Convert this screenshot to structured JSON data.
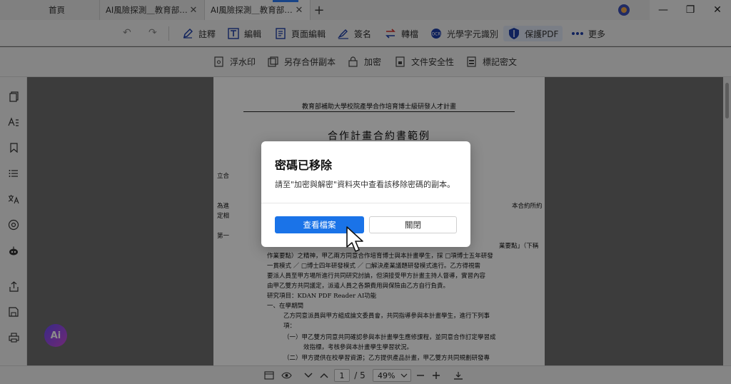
{
  "tabs": [
    {
      "label": "首頁"
    },
    {
      "label": "AI風險探測＿教育部補助..."
    },
    {
      "label": "AI風險探測＿教育部補助..."
    }
  ],
  "tab_close_glyph": "✕",
  "new_tab_glyph": "+",
  "window_controls": {
    "minimize": "—",
    "maximize": "❐",
    "close": "✕"
  },
  "toolbar": {
    "undo_glyph": "↶",
    "redo_glyph": "↷",
    "items": [
      {
        "label": "註釋",
        "icon": "pen-icon"
      },
      {
        "label": "編輯",
        "icon": "edit-text-icon"
      },
      {
        "label": "頁面編輯",
        "icon": "page-edit-icon"
      },
      {
        "label": "簽名",
        "icon": "signature-icon"
      },
      {
        "label": "轉檔",
        "icon": "convert-icon"
      },
      {
        "label": "光學字元識別",
        "icon": "ocr-icon"
      },
      {
        "label": "保護PDF",
        "icon": "shield-icon"
      },
      {
        "label": "更多",
        "icon": "more-icon"
      }
    ]
  },
  "subtoolbar": {
    "items": [
      {
        "label": "浮水印"
      },
      {
        "label": "另存合併副本"
      },
      {
        "label": "加密"
      },
      {
        "label": "文件安全性"
      },
      {
        "label": "標記密文"
      }
    ]
  },
  "document": {
    "header": "教育部補助大學校院產學合作培育博士級研發人才計畫",
    "title": "合作計畫合約書範例",
    "lines": [
      "立合",
      "為進",
      "定相",
      "第一",
      "業要點」（下稱",
      "本合約所約",
      "作業要點）之精神，甲乙兩方同意合作培育博士與本計畫學生，採 □項博士五年研發",
      "一貫模式 ／ □博士四年研發模式 ／ □解決產業議題研發模式進行。乙方得視需",
      "要派人員至甲方場所進行共同研究討論，但須接受甲方計畫主持人督導，實習內容",
      "由甲乙雙方共同議定，派遣人員之各類費用與保險由乙方自行負責。",
      "研究項目：KDAN PDF Reader AI功能",
      "一、在學期間",
      "乙方同意派員與甲方組成論文委員會，共同指導參與本計畫學生，進行下列事",
      "項：",
      "（一）甲乙雙方同意共同確認參與本計畫學生應修課程，並同意合作訂定學習成",
      "效指標，考核參與本計畫學生學習狀況。",
      "（二）甲方提供在校學習資源；乙方提供產品計畫，甲乙雙方共同規劃研發專"
    ]
  },
  "bottombar": {
    "current_page": "1",
    "total_pages": "/ 5",
    "zoom": "49%"
  },
  "dialog": {
    "title": "密碼已移除",
    "message": "請至\"加密與解密\"資料夾中查看該移除密碼的副本。",
    "primary_button": "查看檔案",
    "secondary_button": "關閉"
  },
  "ai_button": "Ai",
  "colors": {
    "accent": "#1a73e8",
    "icon_blue": "#1e3fa8"
  }
}
